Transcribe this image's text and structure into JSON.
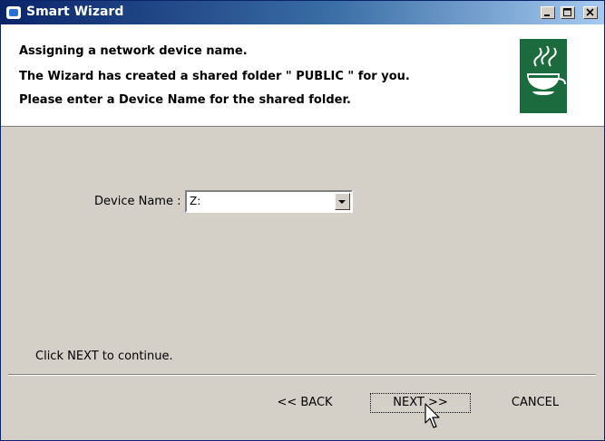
{
  "window": {
    "title": "Smart Wizard"
  },
  "titlebar": {
    "minimize_icon": "minimize-icon",
    "maximize_icon": "maximize-icon",
    "close_icon": "close-icon"
  },
  "header": {
    "lines": [
      "Assigning a network device name.",
      "The Wizard has created a shared folder \" PUBLIC \" for you.",
      "Please enter a Device Name for the shared folder."
    ],
    "logo_icon": "steaming-bowl-logo-icon"
  },
  "form": {
    "device_name_label": "Device Name :",
    "device_name_value": "Z:"
  },
  "footer": {
    "hint": "Click NEXT to continue.",
    "back_label": "<< BACK",
    "next_label": "NEXT >>",
    "cancel_label": "CANCEL"
  },
  "colors": {
    "titlebar": "#0a246a",
    "header_bg": "#ffffff",
    "body_bg": "#d4d0c8",
    "logo_bg": "#1c6b3f"
  }
}
